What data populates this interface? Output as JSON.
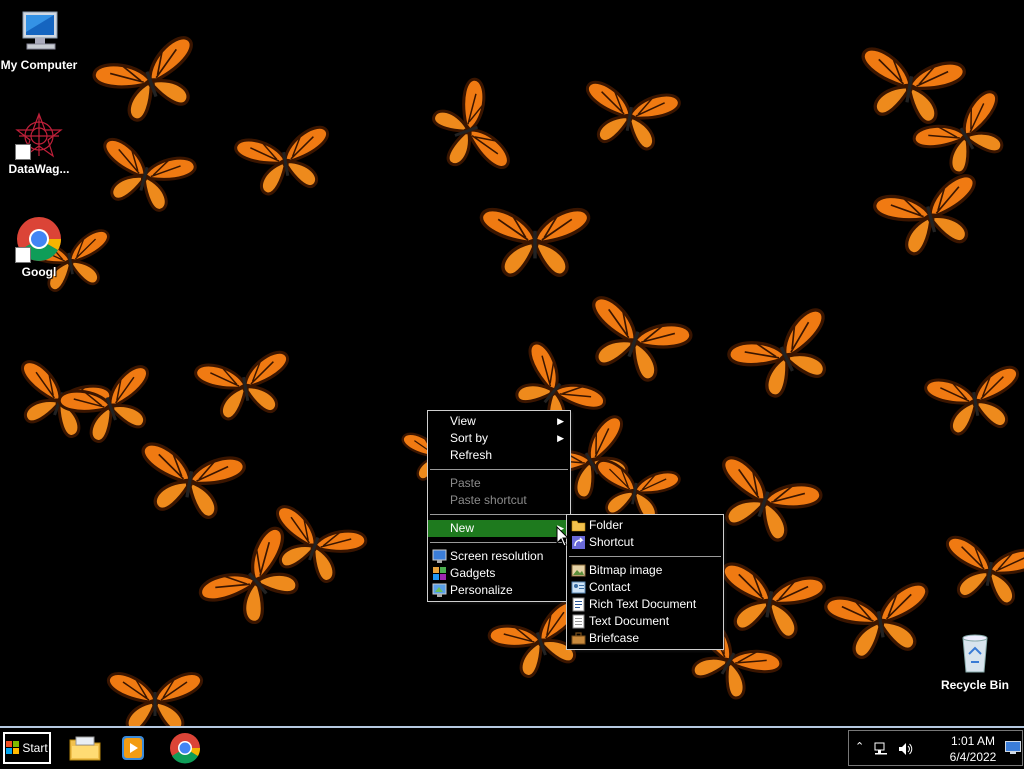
{
  "desktop": {
    "icons": [
      {
        "label": "My Computer"
      },
      {
        "label": "DataWag..."
      },
      {
        "label": "Googl"
      },
      {
        "label": "Recycle Bin"
      }
    ]
  },
  "context_menu": {
    "items": [
      {
        "label": "View",
        "submenu": true
      },
      {
        "label": "Sort by",
        "submenu": true
      },
      {
        "label": "Refresh"
      },
      {
        "label": "Paste",
        "disabled": true
      },
      {
        "label": "Paste shortcut",
        "disabled": true
      },
      {
        "label": "New",
        "submenu": true,
        "highlighted": true
      },
      {
        "label": "Screen resolution"
      },
      {
        "label": "Gadgets"
      },
      {
        "label": "Personalize"
      }
    ],
    "highlight_color": "#1e7a1e"
  },
  "new_submenu": {
    "items": [
      {
        "label": "Folder",
        "icon": "folder-icon"
      },
      {
        "label": "Shortcut",
        "icon": "shortcut-icon"
      },
      {
        "label": "Bitmap image",
        "icon": "bitmap-icon"
      },
      {
        "label": "Contact",
        "icon": "contact-icon"
      },
      {
        "label": "Rich Text Document",
        "icon": "rich-text-icon"
      },
      {
        "label": "Text Document",
        "icon": "text-document-icon"
      },
      {
        "label": "Briefcase",
        "icon": "briefcase-icon"
      }
    ]
  },
  "taskbar": {
    "start_label": "Start",
    "apps": [
      {
        "name": "Windows Explorer",
        "icon": "explorer-folder-icon"
      },
      {
        "name": "Windows Media Player",
        "icon": "media-player-icon"
      },
      {
        "name": "Google Chrome",
        "icon": "chrome-icon"
      }
    ],
    "tray": {
      "time": "1:01 AM",
      "date": "6/4/2022"
    }
  },
  "colors": {
    "butterfly_orange": "#f07a12",
    "butterfly_dark": "#3a1500",
    "background": "#000000",
    "taskbar_border": "#b5c9e0"
  }
}
